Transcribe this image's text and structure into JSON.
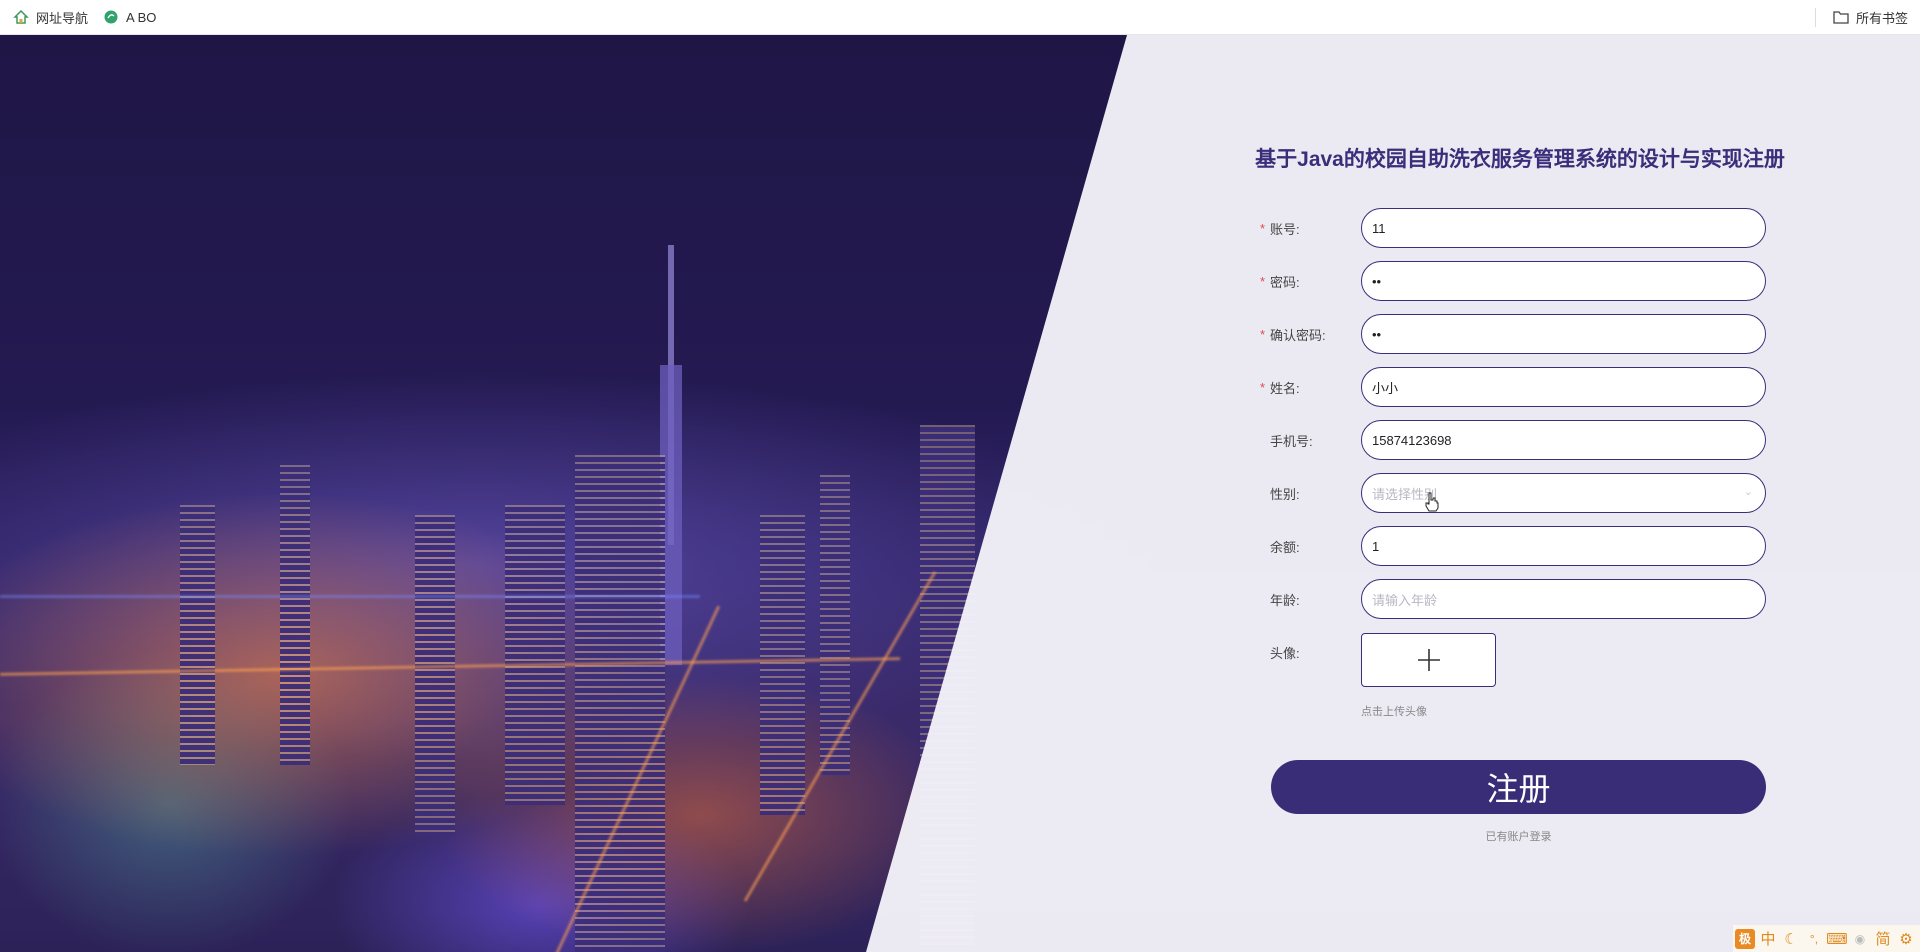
{
  "bookmarks": {
    "nav_label": "网址导航",
    "abo_label": "A BO",
    "all_label": "所有书签",
    "icons": {
      "nav": "home-icon",
      "abo": "leaf-icon",
      "all": "folder-icon"
    }
  },
  "form": {
    "title": "基于Java的校园自助洗衣服务管理系统的设计与实现注册",
    "fields": [
      {
        "label": "账号:",
        "required": true,
        "value": "11"
      },
      {
        "label": "密码:",
        "required": true,
        "value": "••"
      },
      {
        "label": "确认密码:",
        "required": true,
        "value": "••"
      },
      {
        "label": "姓名:",
        "required": true,
        "value": "小小"
      },
      {
        "label": "手机号:",
        "required": false,
        "value": "15874123698"
      },
      {
        "label": "性别:",
        "required": false,
        "placeholder": "请选择性别"
      },
      {
        "label": "余额:",
        "required": false,
        "value": "1"
      },
      {
        "label": "年龄:",
        "required": false,
        "placeholder": "请输入年龄"
      }
    ],
    "avatar_label": "头像:",
    "upload_hint": "点击上传头像",
    "submit_label": "注册",
    "login_link": "已有账户登录"
  },
  "ime": {
    "logo": "极",
    "mode": "中",
    "moon": "☾",
    "punct": "°,",
    "keyboard": "⌨",
    "user": "👤",
    "script": "简",
    "settings": "⚙"
  },
  "colors": {
    "accent": "#3a2d78",
    "required_star": "#e04b4b",
    "ime_orange": "#e08a1e"
  }
}
